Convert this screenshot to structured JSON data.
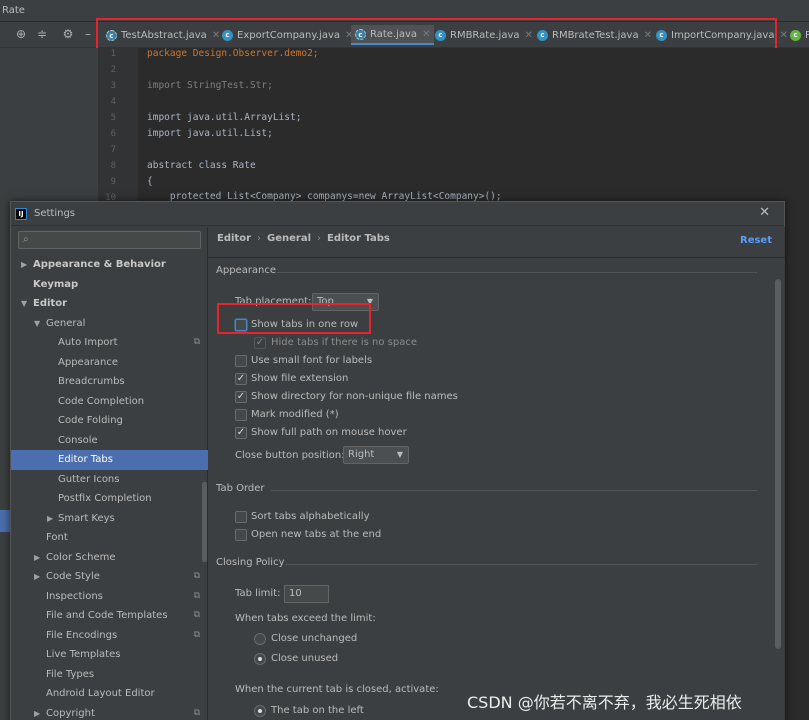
{
  "ide": {
    "window_title": "Rate",
    "tabs": [
      {
        "label": "TestAbstract.java",
        "icon": "abstract-class-icon",
        "active": false
      },
      {
        "label": "ExportCompany.java",
        "icon": "class-icon",
        "active": false
      },
      {
        "label": "Rate.java",
        "icon": "abstract-class-icon",
        "active": true
      },
      {
        "label": "RMBRate.java",
        "icon": "class-icon",
        "active": false
      },
      {
        "label": "RMBrateTest.java",
        "icon": "class-icon",
        "active": false
      },
      {
        "label": "ImportCompany.java",
        "icon": "class-icon",
        "active": false
      },
      {
        "label": "P",
        "icon": "package-icon",
        "active": false
      }
    ],
    "code_lines": [
      {
        "n": "1",
        "text": "package Design.Observer.demo2;"
      },
      {
        "n": "2",
        "text": ""
      },
      {
        "n": "3",
        "text": "import StringTest.Str;"
      },
      {
        "n": "4",
        "text": ""
      },
      {
        "n": "5",
        "text": "import java.util.ArrayList;"
      },
      {
        "n": "6",
        "text": "import java.util.List;"
      },
      {
        "n": "7",
        "text": ""
      },
      {
        "n": "8",
        "text": "abstract class Rate"
      },
      {
        "n": "9",
        "text": "{"
      },
      {
        "n": "10",
        "text": "    protected List<Company> companys=new ArrayList<Company>();"
      }
    ]
  },
  "dialog": {
    "title": "Settings",
    "search_placeholder": "",
    "breadcrumb": [
      "Editor",
      "General",
      "Editor Tabs"
    ],
    "reset_label": "Reset",
    "tree": [
      {
        "label": "Appearance & Behavior",
        "level": 0,
        "arrow": "▶",
        "bold": true
      },
      {
        "label": "Keymap",
        "level": 0,
        "arrow": "",
        "bold": true
      },
      {
        "label": "Editor",
        "level": 0,
        "arrow": "▼",
        "bold": true
      },
      {
        "label": "General",
        "level": 1,
        "arrow": "▼"
      },
      {
        "label": "Auto Import",
        "level": 2,
        "marker": "⧉"
      },
      {
        "label": "Appearance",
        "level": 2
      },
      {
        "label": "Breadcrumbs",
        "level": 2
      },
      {
        "label": "Code Completion",
        "level": 2
      },
      {
        "label": "Code Folding",
        "level": 2
      },
      {
        "label": "Console",
        "level": 2
      },
      {
        "label": "Editor Tabs",
        "level": 2,
        "selected": true
      },
      {
        "label": "Gutter Icons",
        "level": 2
      },
      {
        "label": "Postfix Completion",
        "level": 2
      },
      {
        "label": "Smart Keys",
        "level": 2,
        "arrow": "▶"
      },
      {
        "label": "Font",
        "level": 1
      },
      {
        "label": "Color Scheme",
        "level": 1,
        "arrow": "▶"
      },
      {
        "label": "Code Style",
        "level": 1,
        "arrow": "▶",
        "marker": "⧉"
      },
      {
        "label": "Inspections",
        "level": 1,
        "marker": "⧉"
      },
      {
        "label": "File and Code Templates",
        "level": 1,
        "marker": "⧉"
      },
      {
        "label": "File Encodings",
        "level": 1,
        "marker": "⧉"
      },
      {
        "label": "Live Templates",
        "level": 1
      },
      {
        "label": "File Types",
        "level": 1
      },
      {
        "label": "Android Layout Editor",
        "level": 1
      },
      {
        "label": "Copyright",
        "level": 1,
        "arrow": "▶",
        "marker": "⧉"
      }
    ],
    "appearance": {
      "section_title": "Appearance",
      "tab_placement_label": "Tab placement:",
      "tab_placement_value": "Top",
      "show_tabs_one_row": {
        "label": "Show tabs in one row",
        "checked": false
      },
      "hide_tabs_no_space": {
        "label": "Hide tabs if there is no space",
        "checked": true,
        "disabled": true
      },
      "small_font": {
        "label": "Use small font for labels",
        "checked": false
      },
      "file_extension": {
        "label": "Show file extension",
        "checked": true
      },
      "directory_non_unique": {
        "label": "Show directory for non-unique file names",
        "checked": true
      },
      "mark_modified": {
        "label": "Mark modified (*)",
        "checked": false
      },
      "full_path_hover": {
        "label": "Show full path on mouse hover",
        "checked": true
      },
      "close_button_label": "Close button position:",
      "close_button_value": "Right"
    },
    "tab_order": {
      "section_title": "Tab Order",
      "sort_alpha": {
        "label": "Sort tabs alphabetically",
        "checked": false
      },
      "open_at_end": {
        "label": "Open new tabs at the end",
        "checked": false
      }
    },
    "closing_policy": {
      "section_title": "Closing Policy",
      "tab_limit_label": "Tab limit:",
      "tab_limit_value": "10",
      "exceed_label": "When tabs exceed the limit:",
      "close_unchanged": {
        "label": "Close unchanged",
        "selected": false
      },
      "close_unused": {
        "label": "Close unused",
        "selected": true
      },
      "closed_activate_label": "When the current tab is closed, activate:",
      "tab_on_left": {
        "label": "The tab on the left",
        "selected": true
      }
    }
  },
  "watermark": "CSDN @你若不离不弃，我必生死相依",
  "colors": {
    "accent": "#4b6eaf",
    "highlight_box": "#e8232b",
    "link": "#589df6"
  }
}
